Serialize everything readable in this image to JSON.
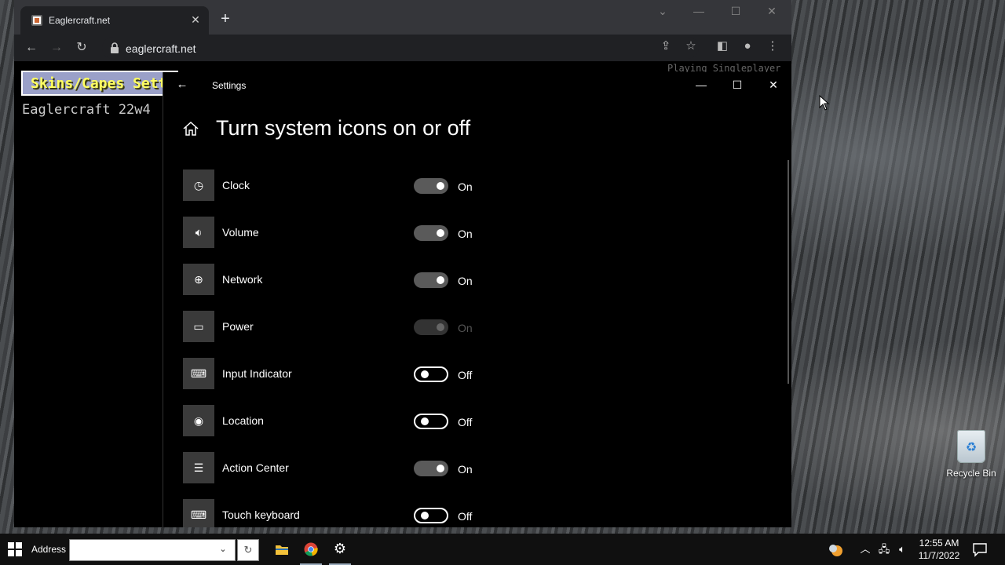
{
  "browser": {
    "tab_title": "Eaglercraft.net",
    "tab_close": "✕",
    "new_tab": "+",
    "url": "eaglercraft.net"
  },
  "game": {
    "button_label": "Skins/Capes Sett",
    "version_text": "Eaglercraft 22w4",
    "status_text": "Playing Singleplayer"
  },
  "settings": {
    "window_title": "Settings",
    "page_title": "Turn system icons on or off",
    "items": [
      {
        "label": "Clock",
        "icon": "clock-icon",
        "state": "On"
      },
      {
        "label": "Volume",
        "icon": "volume-icon",
        "state": "On"
      },
      {
        "label": "Network",
        "icon": "network-icon",
        "state": "On"
      },
      {
        "label": "Power",
        "icon": "battery-icon",
        "state": "On",
        "disabled": true
      },
      {
        "label": "Input Indicator",
        "icon": "keyboard-icon",
        "state": "Off"
      },
      {
        "label": "Location",
        "icon": "location-icon",
        "state": "Off"
      },
      {
        "label": "Action Center",
        "icon": "action-center-icon",
        "state": "On"
      },
      {
        "label": "Touch keyboard",
        "icon": "keyboard-icon",
        "state": "Off"
      }
    ]
  },
  "desktop": {
    "recycle_bin_label": "Recycle Bin"
  },
  "taskbar": {
    "address_label": "Address",
    "address_value": "",
    "time": "12:55 AM",
    "date": "11/7/2022"
  },
  "colors": {
    "settings_bg": "#000000",
    "toggle_on": "#5a5a5a",
    "taskbar_bg": "#101010",
    "tabstrip_bg": "#35363a",
    "toolbar_bg": "#202124"
  }
}
